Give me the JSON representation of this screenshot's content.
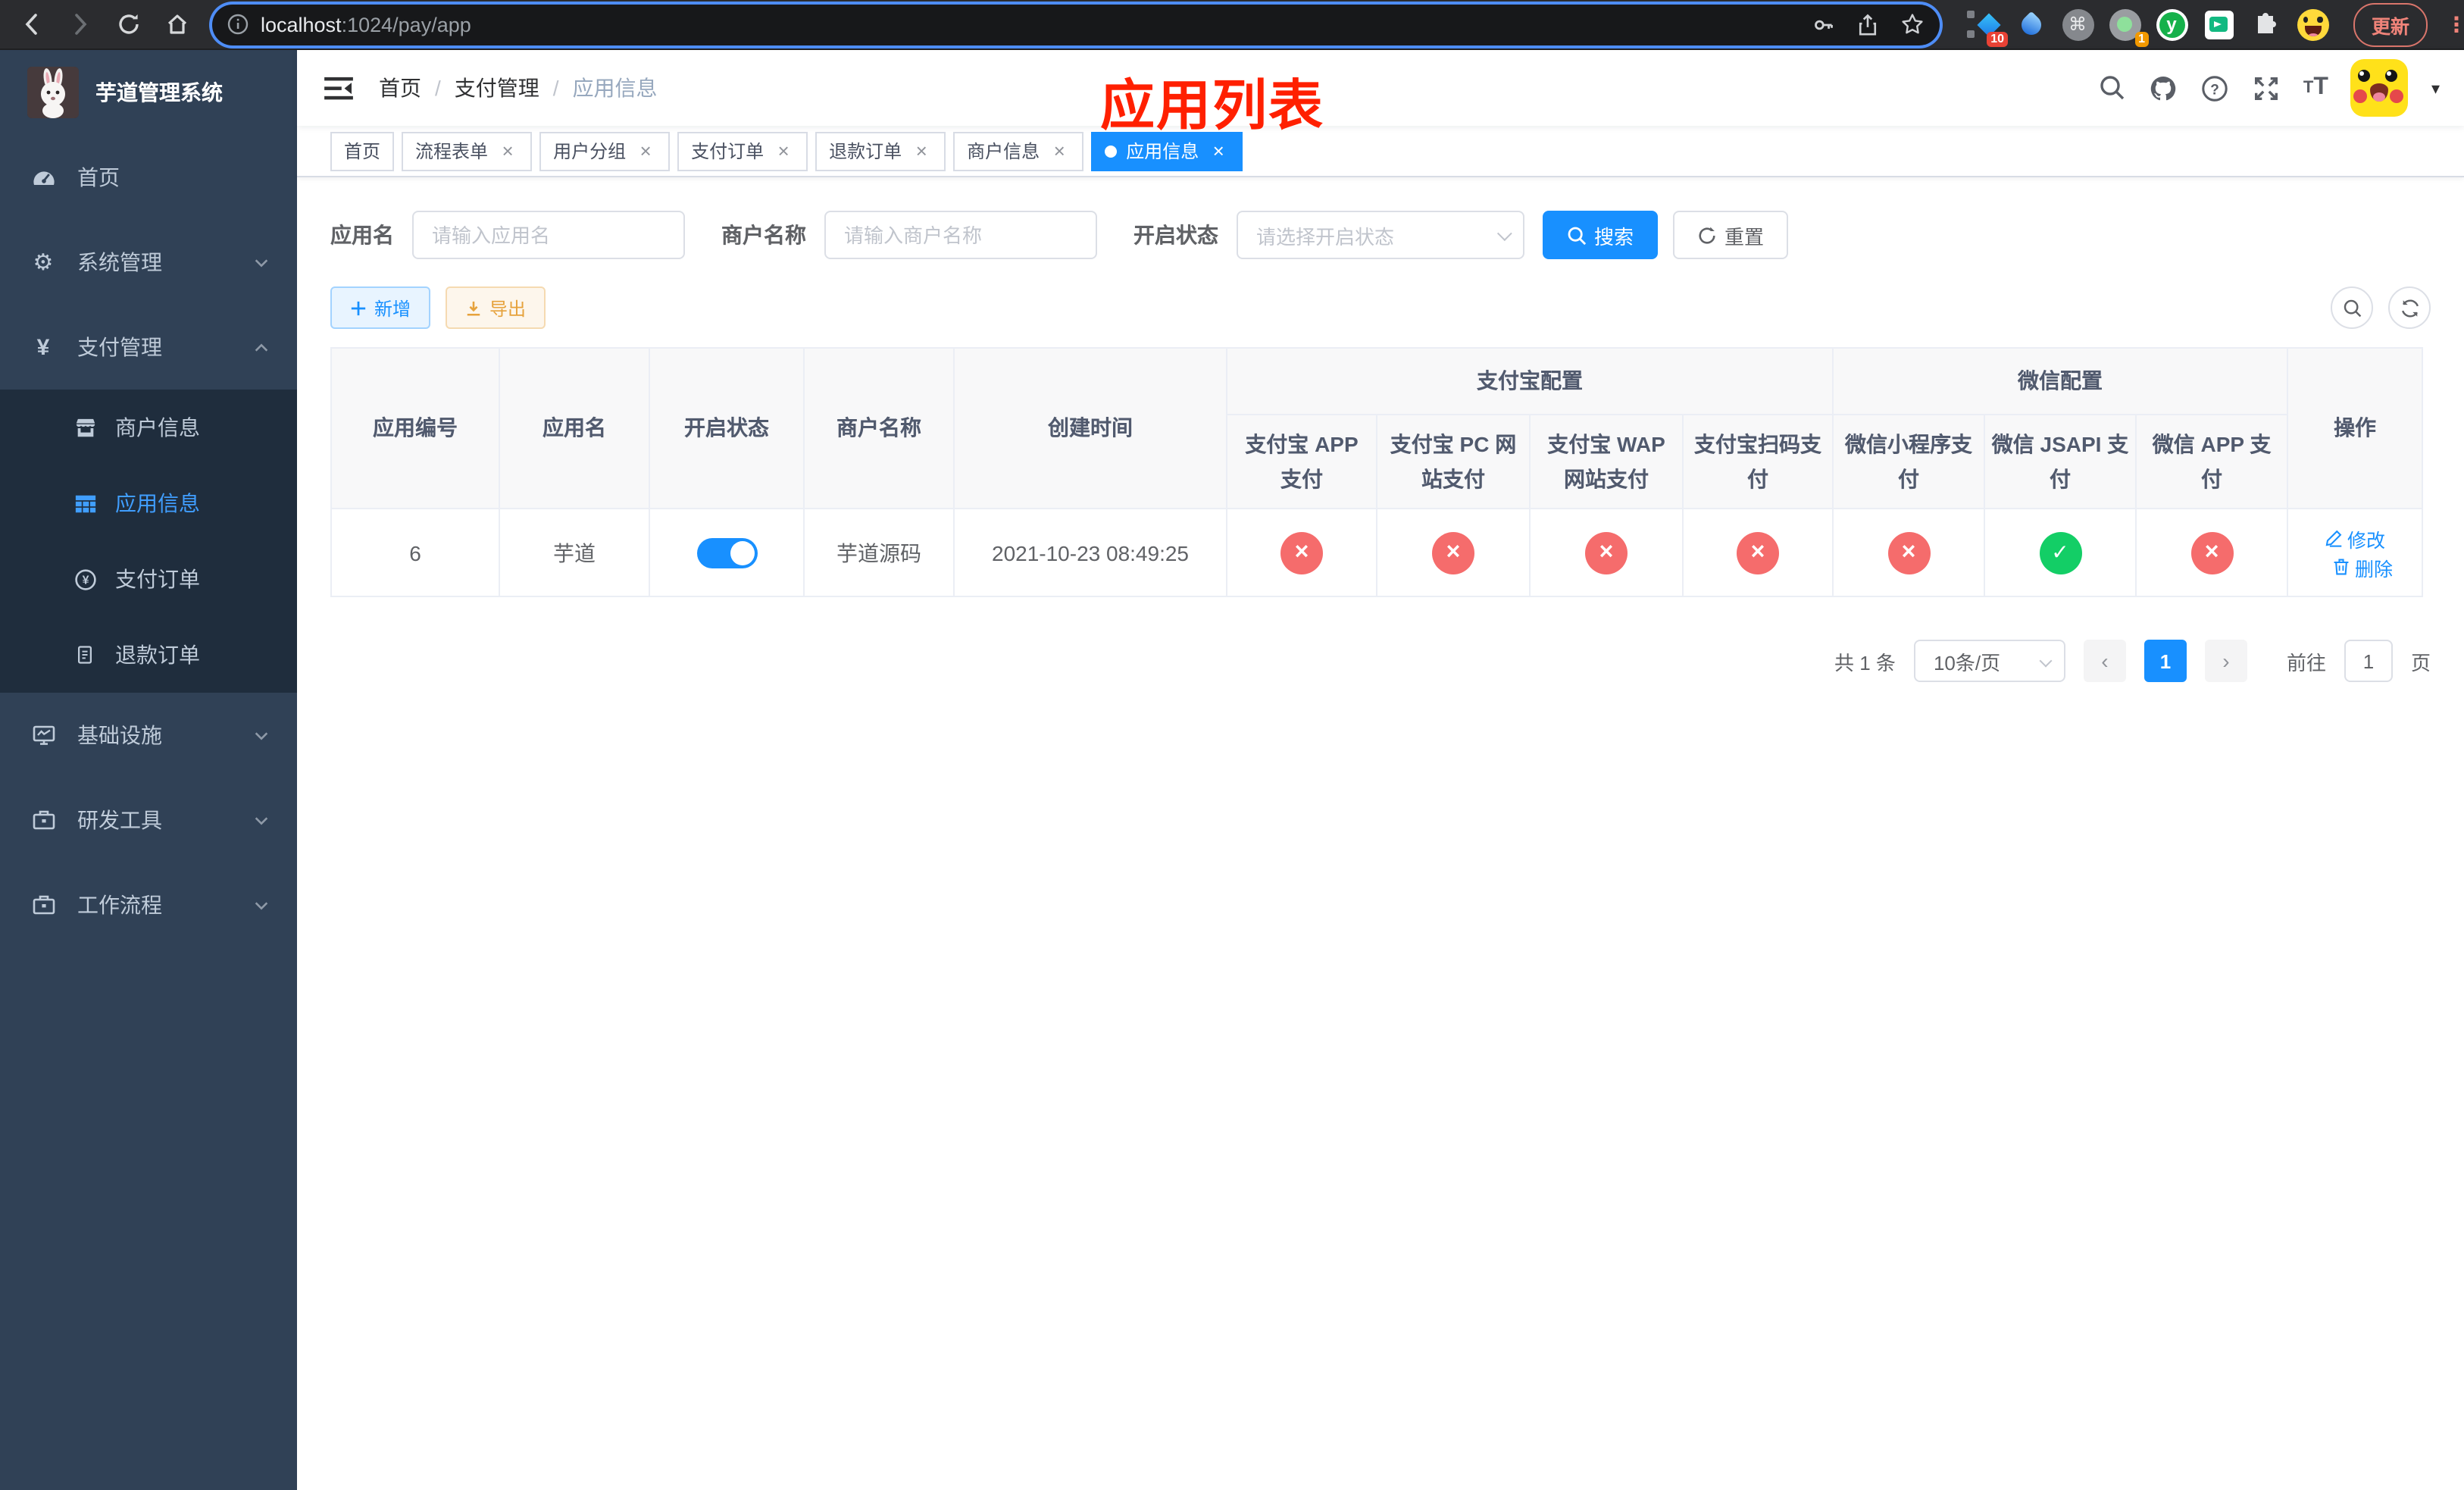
{
  "browser": {
    "url_host": "localhost",
    "url_rest": ":1024/pay/app",
    "update_label": "更新",
    "ext_badge_pin": "10",
    "ext_badge_rec": "1",
    "ext_y_letter": "y",
    "cmd_glyph": "⌘"
  },
  "sidebar": {
    "title": "芋道管理系统",
    "menu": [
      {
        "label": "首页"
      },
      {
        "label": "系统管理"
      },
      {
        "label": "支付管理"
      },
      {
        "label": "基础设施"
      },
      {
        "label": "研发工具"
      },
      {
        "label": "工作流程"
      }
    ],
    "submenu": [
      {
        "label": "商户信息"
      },
      {
        "label": "应用信息"
      },
      {
        "label": "支付订单"
      },
      {
        "label": "退款订单"
      }
    ]
  },
  "navbar": {
    "breadcrumb": [
      "首页",
      "支付管理",
      "应用信息"
    ],
    "annotation": "应用列表"
  },
  "tags": {
    "items": [
      {
        "label": "首页"
      },
      {
        "label": "流程表单"
      },
      {
        "label": "用户分组"
      },
      {
        "label": "支付订单"
      },
      {
        "label": "退款订单"
      },
      {
        "label": "商户信息"
      },
      {
        "label": "应用信息"
      }
    ]
  },
  "filters": {
    "app_name_label": "应用名",
    "app_name_placeholder": "请输入应用名",
    "merchant_label": "商户名称",
    "merchant_placeholder": "请输入商户名称",
    "status_label": "开启状态",
    "status_placeholder": "请选择开启状态",
    "search_label": "搜索",
    "reset_label": "重置"
  },
  "toolbar": {
    "add_label": "新增",
    "export_label": "导出"
  },
  "table": {
    "group_alipay": "支付宝配置",
    "group_wechat": "微信配置",
    "col_id": "应用编号",
    "col_name": "应用名",
    "col_status": "开启状态",
    "col_merchant": "商户名称",
    "col_created": "创建时间",
    "col_op": "操作",
    "subcols": [
      "支付宝 APP 支付",
      "支付宝 PC 网站支付",
      "支付宝 WAP 网站支付",
      "支付宝扫码支付",
      "微信小程序支付",
      "微信 JSAPI 支付",
      "微信 APP 支付"
    ],
    "row": {
      "id": "6",
      "name": "芋道",
      "merchant": "芋道源码",
      "created": "2021-10-23 08:49:25",
      "configs": [
        "fail",
        "fail",
        "fail",
        "fail",
        "fail",
        "pass",
        "fail"
      ],
      "edit_label": "修改",
      "delete_label": "删除"
    }
  },
  "pagination": {
    "total": "共 1 条",
    "size": "10条/页",
    "prev": "‹",
    "page": "1",
    "next": "›",
    "goto_label": "前往",
    "goto_value": "1",
    "unit_label": "页"
  }
}
